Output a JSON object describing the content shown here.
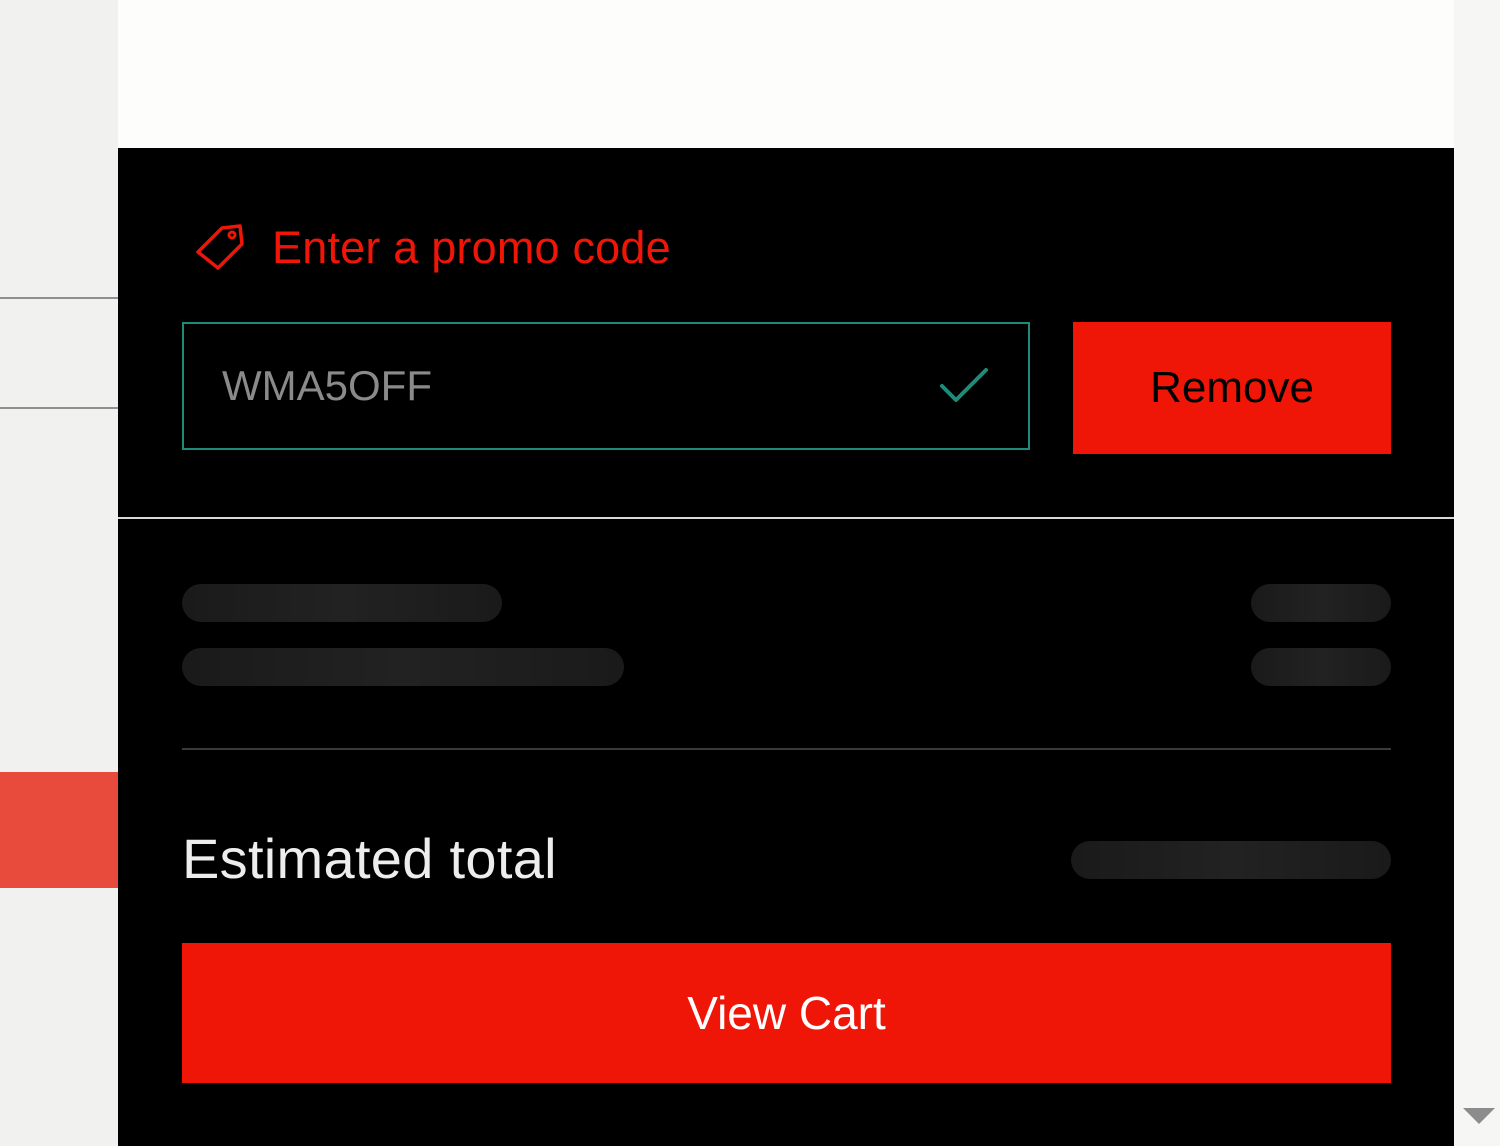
{
  "promo": {
    "heading": "Enter a promo code",
    "code_value": "WMA5OFF",
    "remove_label": "Remove"
  },
  "summary": {
    "total_label": "Estimated total"
  },
  "actions": {
    "view_cart_label": "View Cart"
  },
  "icons": {
    "promo": "tag-icon",
    "valid": "check-icon",
    "scroll": "scroll-down-arrow-icon"
  },
  "colors": {
    "accent_red": "#ef1607",
    "valid_green": "#1d8b78",
    "panel_bg": "#000000",
    "left_red": "#e84a3c"
  }
}
